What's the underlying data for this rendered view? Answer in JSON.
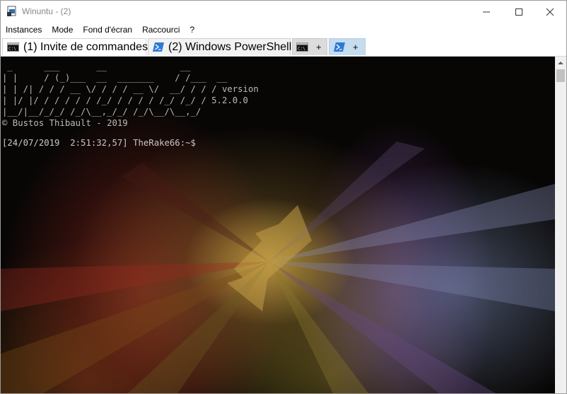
{
  "window": {
    "title": "Winuntu - (2)"
  },
  "menu": [
    "Instances",
    "Mode",
    "Fond d'écran",
    "Raccourci",
    "?"
  ],
  "tabs": [
    {
      "label": "(1) Invite de commandes",
      "icon": "cmd-icon",
      "active": true
    },
    {
      "label": "(2) Windows PowerShell",
      "icon": "powershell-icon",
      "active": false
    }
  ],
  "new_tabs": [
    {
      "label": "+",
      "icon": "cmd-icon"
    },
    {
      "label": "+",
      "icon": "powershell-icon"
    }
  ],
  "terminal": {
    "banner": " _      ___       __              __\n| |     / (_)___  __  _______    / /___  __\n| | /| / / / __ \\/ / / / __ \\/  __/ / / / version\n| |/ |/ / / / / / /_/ / / / / /_/ /_/ / 5.2.0.0\n|__/|__/_/_/ /_/\\__,_/_/ /_/\\__/\\__,_/\n© Bustos Thibault - 2019",
    "prompt": "[24/07/2019  2:51:32,57] TheRake66:~$"
  },
  "colors": {
    "accent": "#2d7ad6",
    "terminal_text": "#b9b9b9"
  }
}
